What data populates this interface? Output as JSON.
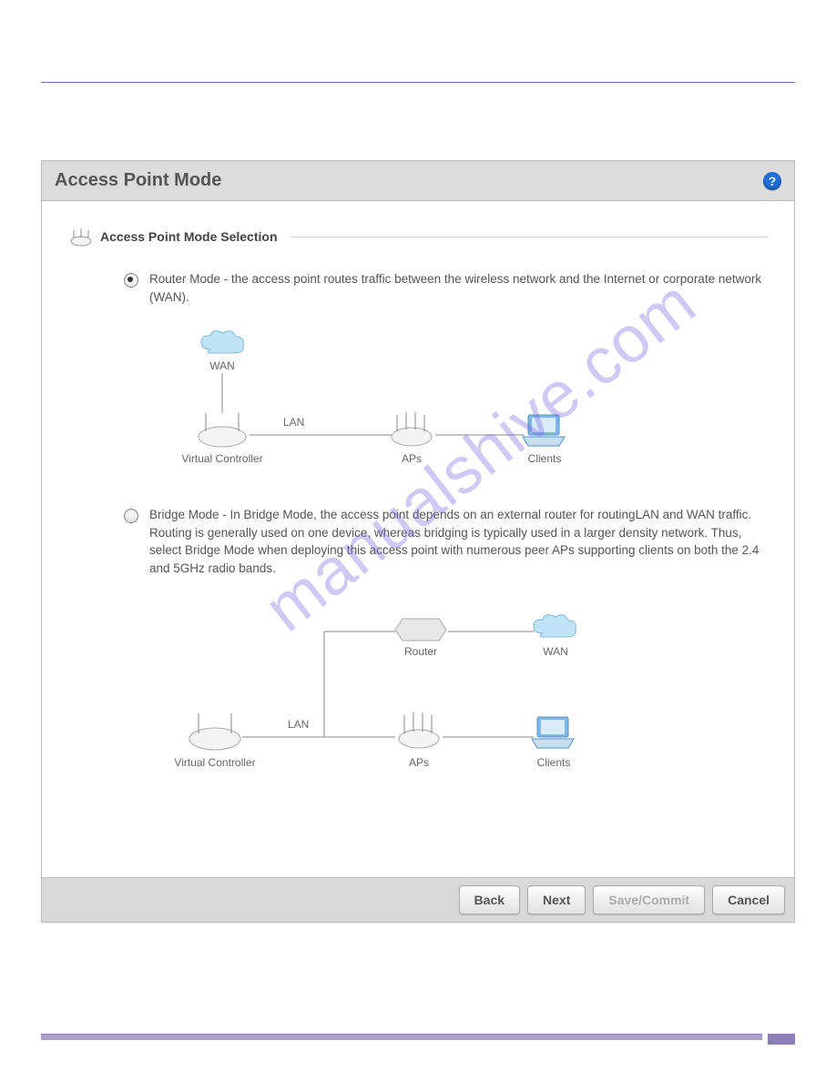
{
  "panel": {
    "title": "Access Point Mode",
    "section_title": "Access Point Mode Selection"
  },
  "options": {
    "router": {
      "selected": true,
      "text": "Router Mode - the access point routes traffic between the wireless network and the Internet or corporate network (WAN)."
    },
    "bridge": {
      "selected": false,
      "text": "Bridge Mode - In Bridge Mode, the access point depends on an external router for routingLAN and WAN traffic. Routing is generally used on one device, whereas bridging is typically used in a larger density network. Thus, select Bridge Mode when deploying this access point with numerous peer APs supporting clients on both the 2.4 and 5GHz radio bands."
    }
  },
  "diagram1": {
    "wan": "WAN",
    "lan": "LAN",
    "vc": "Virtual Controller",
    "aps": "APs",
    "clients": "Clients"
  },
  "diagram2": {
    "router": "Router",
    "wan": "WAN",
    "lan": "LAN",
    "vc": "Virtual Controller",
    "aps": "APs",
    "clients": "Clients"
  },
  "buttons": {
    "back": "Back",
    "next": "Next",
    "save": "Save/Commit",
    "cancel": "Cancel"
  },
  "watermark": "manualshive.com"
}
